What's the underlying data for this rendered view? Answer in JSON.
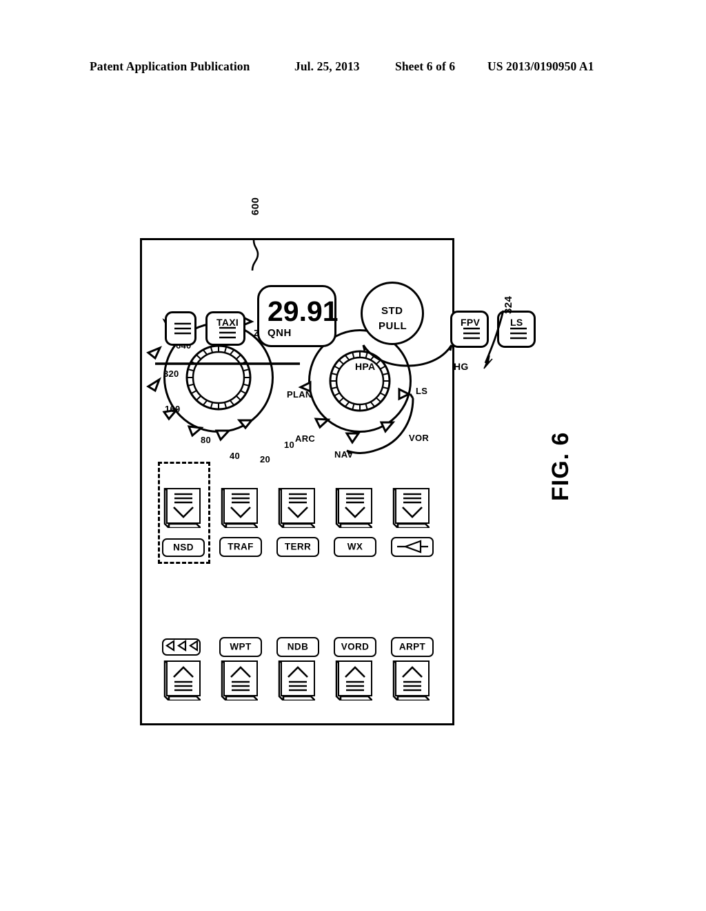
{
  "header": {
    "publication": "Patent Application Publication",
    "date": "Jul. 25, 2013",
    "sheet": "Sheet 6 of 6",
    "number": "US 2013/0190950 A1"
  },
  "figure": {
    "label": "FIG. 6",
    "callouts": [
      {
        "id": "ref-600",
        "text": "600"
      },
      {
        "id": "ref-324",
        "text": "324"
      }
    ]
  },
  "panel": {
    "name": "navigation-display-control-panel",
    "button_rows": [
      {
        "left_chevron": ">",
        "left_label": "",
        "right_label": "NSD",
        "right_chevron": "<",
        "highlighted": true,
        "extra": "triangles"
      },
      {
        "left_chevron": ">",
        "left_label": "WPT",
        "right_label": "TRAF",
        "right_chevron": "<",
        "highlighted": false,
        "extra": ""
      },
      {
        "left_chevron": ">",
        "left_label": "NDB",
        "right_label": "TERR",
        "right_chevron": "<",
        "highlighted": false,
        "extra": ""
      },
      {
        "left_chevron": ">",
        "left_label": "VORD",
        "right_label": "WX",
        "right_chevron": "<",
        "highlighted": false,
        "extra": ""
      },
      {
        "left_chevron": ">",
        "left_label": "ARPT",
        "right_label": "",
        "right_chevron": "<",
        "highlighted": false,
        "extra": "aircraft-symbol"
      }
    ],
    "zoom_knob": {
      "name": "zoom-range-knob",
      "caption": "ZOOM",
      "positions": [
        "10",
        "20",
        "40",
        "80",
        "160",
        "320",
        "640"
      ]
    },
    "mode_knob": {
      "name": "nav-mode-knob",
      "positions": [
        "LS",
        "VOR",
        "NAV",
        "ARC",
        "PLAN"
      ],
      "arc_from": "LS",
      "arc_to": "NAV"
    },
    "baro": {
      "qnh_label": "QNH",
      "qnh_value": "29.91",
      "std_knob_line1": "PULL",
      "std_knob_line2": "STD",
      "unit_left": "HG",
      "unit_right": "HPA"
    },
    "bottom_keys_left": [
      {
        "label": ""
      },
      {
        "label": "TAXI"
      }
    ],
    "bottom_keys_right": [
      {
        "label": "FPV"
      },
      {
        "label": "LS"
      }
    ]
  }
}
